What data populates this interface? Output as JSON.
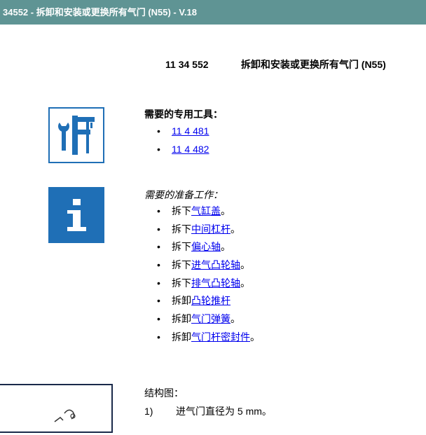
{
  "title_bar": "34552 - 拆卸和安装或更换所有气门 (N55) - V.18",
  "heading": {
    "code": "11 34 552",
    "title": "拆卸和安装或更换所有气门 (N55)"
  },
  "special_tools": {
    "icon": "tools-icon",
    "title": "需要的专用工具：",
    "items": [
      "11 4 481",
      "11 4 482"
    ]
  },
  "prep_work": {
    "icon": "info-icon",
    "title": "需要的准备工作：",
    "items": [
      {
        "prefix": "拆下",
        "link": "气缸盖",
        "suffix": "。"
      },
      {
        "prefix": "拆下",
        "link": "中间杠杆",
        "suffix": "。"
      },
      {
        "prefix": "拆下",
        "link": "偏心轴",
        "suffix": "。"
      },
      {
        "prefix": "拆下",
        "link": "进气凸轮轴",
        "suffix": "。"
      },
      {
        "prefix": "拆下",
        "link": "排气凸轮轴",
        "suffix": "。"
      },
      {
        "prefix": "拆卸",
        "link": "凸轮推杆",
        "suffix": ""
      },
      {
        "prefix": "拆卸",
        "link": "气门弹簧",
        "suffix": "。"
      },
      {
        "prefix": "拆卸",
        "link": "气门杆密封件",
        "suffix": "。"
      }
    ]
  },
  "structure": {
    "title": "结构图：",
    "items": [
      {
        "num": "1)",
        "text": "进气门直径为  5 mm。"
      }
    ]
  }
}
